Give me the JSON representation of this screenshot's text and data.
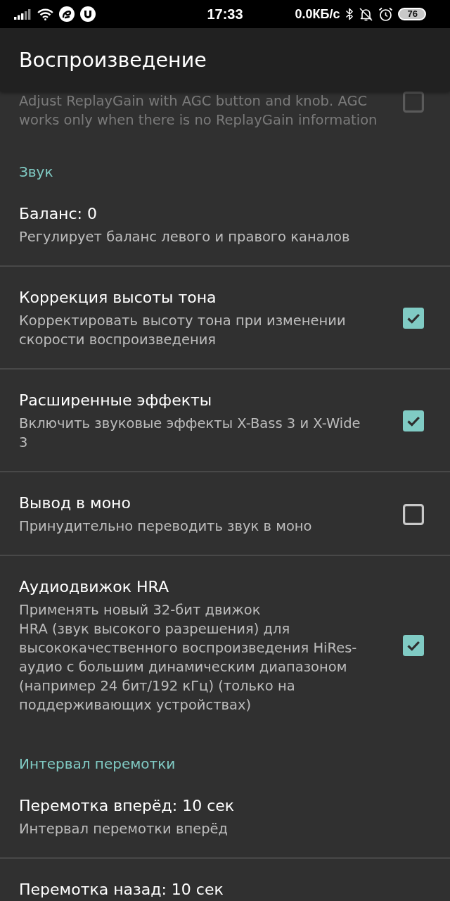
{
  "status_bar": {
    "time": "17:33",
    "net_speed": "0.0КБ/с",
    "battery": "76"
  },
  "app_bar": {
    "title": "Воспроизведение"
  },
  "items": [
    {
      "kind": "checkbox",
      "description": "Adjust ReplayGain with AGC button and knob. AGC works only when there is no ReplayGain information",
      "checked": false,
      "disabled": true
    },
    {
      "kind": "category",
      "title": "Звук"
    },
    {
      "kind": "text",
      "title": "Баланс: 0",
      "description": "Регулирует баланс левого и правого каналов",
      "disabled": false
    },
    {
      "kind": "checkbox",
      "title": "Коррекция высоты тона",
      "description": "Корректировать высоту тона при изменении скорости воспроизведения",
      "checked": true,
      "disabled": false
    },
    {
      "kind": "checkbox",
      "title": "Расширенные эффекты",
      "description": "Включить звуковые эффекты X-Bass 3 и X-Wide 3",
      "checked": true,
      "disabled": false
    },
    {
      "kind": "checkbox",
      "title": "Вывод в моно",
      "description": "Принудительно переводить звук в моно",
      "checked": false,
      "disabled": false
    },
    {
      "kind": "checkbox",
      "title": "Аудиодвижок HRA",
      "description": "Применять новый 32-бит движок\nHRA (звук высокого разрешения) для высококачественного воспроизведения HiRes-аудио с большим динамическим диапазоном (например 24 бит/192 кГц) (только на поддерживающих устройствах)",
      "checked": true,
      "disabled": false
    },
    {
      "kind": "category",
      "title": "Интервал перемотки"
    },
    {
      "kind": "text",
      "title": "Перемотка вперёд: 10 сек",
      "description": "Интервал перемотки вперёд",
      "disabled": false
    },
    {
      "kind": "text",
      "title": "Перемотка назад: 10 сек",
      "disabled": false
    }
  ]
}
